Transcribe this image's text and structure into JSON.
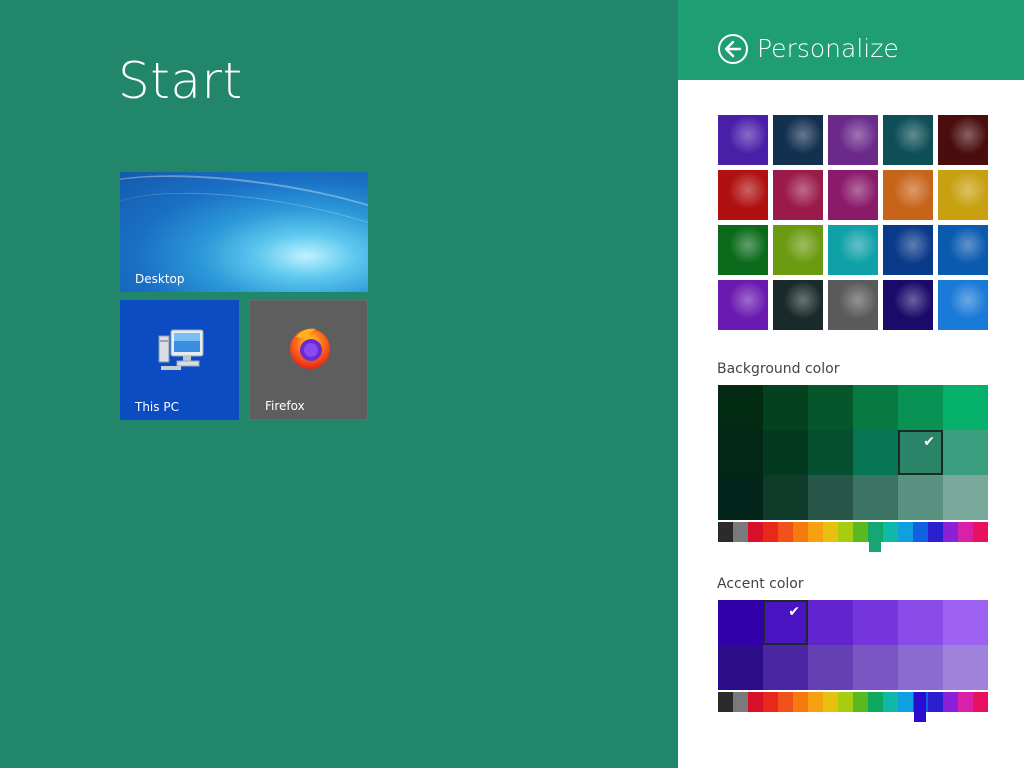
{
  "start": {
    "title": "Start",
    "tiles": {
      "desktop": "Desktop",
      "this_pc": "This PC",
      "firefox": "Firefox"
    }
  },
  "personalize": {
    "title": "Personalize",
    "background_label": "Background color",
    "accent_label": "Accent color",
    "patterns": [
      [
        "#4a1fa8",
        "#13304f",
        "#6b2a8a",
        "#0e4f57",
        "#4a0d0d"
      ],
      [
        "#b01010",
        "#9a1a4a",
        "#8a1a6a",
        "#c8641a",
        "#c8a010"
      ],
      [
        "#0a6a1a",
        "#6a9a10",
        "#10a0a8",
        "#0a3a8a",
        "#0a5ab0"
      ],
      [
        "#6a1ab0",
        "#1a2a2a",
        "#5a5a5a",
        "#1a0a6a",
        "#1a7ad8"
      ]
    ],
    "background_grid": [
      [
        "#032b14",
        "#04421f",
        "#05562a",
        "#067a41",
        "#089355",
        "#04b06a"
      ],
      [
        "#032616",
        "#03391e",
        "#064e30",
        "#067553",
        "#2a8468",
        "#3b9e7e"
      ],
      [
        "#03241a",
        "#103a2a",
        "#28574a",
        "#3c7463",
        "#5a9282",
        "#78a99a"
      ]
    ],
    "background_selected": {
      "row": 1,
      "col": 4
    },
    "accent_grid": [
      [
        "#3200a8",
        "#4a14c2",
        "#6224cf",
        "#7436dc",
        "#8a4be8",
        "#9e62f2"
      ],
      [
        "#2c0e8a",
        "#4a26a4",
        "#6440b2",
        "#7a56c2",
        "#8c6bd0",
        "#9e82dc"
      ]
    ],
    "accent_selected": {
      "row": 0,
      "col": 1
    },
    "hue_colors": [
      "#2b2b2b",
      "#7a7a7a",
      "#d8102a",
      "#e8281a",
      "#f0501a",
      "#f57a10",
      "#f7a010",
      "#e8c010",
      "#a8cc10",
      "#5ab820",
      "#0fa860",
      "#10b8a8",
      "#10a0e0",
      "#1060e0",
      "#2a20d0",
      "#8a20d8",
      "#d820a8",
      "#e81060"
    ],
    "background_hue_index": 11,
    "accent_hue_index": 14,
    "colors": {
      "start_bg": "#22866a",
      "header_bg": "#1e9e72",
      "thumb_bg": "#17a673",
      "thumb_accent": "#2a0cd0"
    }
  }
}
